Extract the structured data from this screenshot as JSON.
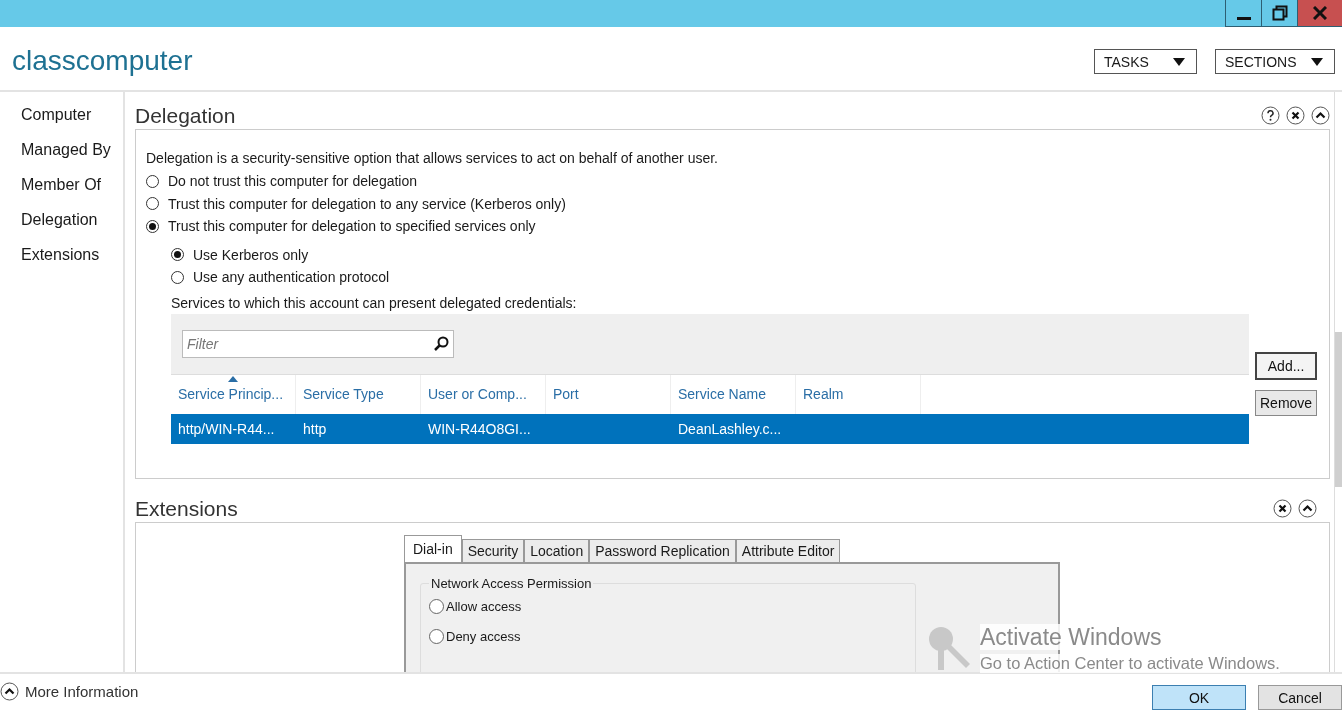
{
  "header": {
    "title": "classcomputer",
    "menus": [
      "TASKS",
      "SECTIONS"
    ]
  },
  "nav": {
    "items": [
      "Computer",
      "Managed By",
      "Member Of",
      "Delegation",
      "Extensions"
    ]
  },
  "delegation": {
    "title": "Delegation",
    "description": "Delegation is a security-sensitive option that allows services to act on behalf of another user.",
    "options": [
      {
        "label": "Do not trust this computer for delegation",
        "selected": false
      },
      {
        "label": "Trust this computer for delegation to any service (Kerberos only)",
        "selected": false
      },
      {
        "label": "Trust this computer for delegation to specified services only",
        "selected": true
      }
    ],
    "protocol_options": [
      {
        "label": "Use Kerberos only",
        "selected": true
      },
      {
        "label": "Use any authentication protocol",
        "selected": false
      }
    ],
    "services_label": "Services to which this account can present delegated credentials:",
    "filter": {
      "placeholder": "Filter"
    },
    "columns": [
      {
        "label": "Service Princip...",
        "sorted": true
      },
      {
        "label": "Service Type",
        "sorted": false
      },
      {
        "label": "User or Comp...",
        "sorted": false
      },
      {
        "label": "Port",
        "sorted": false
      },
      {
        "label": "Service Name",
        "sorted": false
      },
      {
        "label": "Realm",
        "sorted": false
      }
    ],
    "rows": [
      {
        "selected": true,
        "cells": [
          "http/WIN-R44...",
          "http",
          "WIN-R44O8GI...",
          "",
          "DeanLashley.c...",
          ""
        ]
      }
    ],
    "buttons": [
      "Add...",
      "Remove"
    ]
  },
  "extensions": {
    "title": "Extensions",
    "tabs": [
      {
        "label": "Dial-in",
        "selected": true
      },
      {
        "label": "Security",
        "selected": false
      },
      {
        "label": "Location",
        "selected": false
      },
      {
        "label": "Password Replication",
        "selected": false
      },
      {
        "label": "Attribute Editor",
        "selected": false
      }
    ],
    "group_title": "Network Access Permission",
    "options": [
      {
        "label": "Allow access",
        "selected": false
      },
      {
        "label": "Deny access",
        "selected": false
      }
    ]
  },
  "footer": {
    "more_info": "More Information",
    "buttons": [
      {
        "label": "OK",
        "default": true
      },
      {
        "label": "Cancel",
        "default": false
      }
    ]
  },
  "activation": {
    "title": "Activate Windows",
    "subtitle": "Go to Action Center to activate Windows."
  }
}
